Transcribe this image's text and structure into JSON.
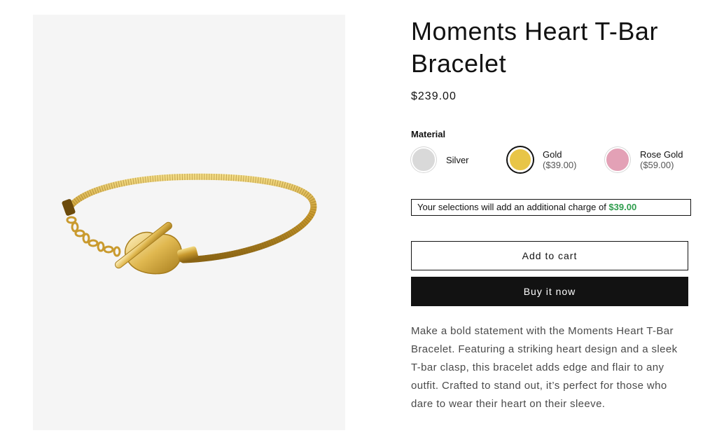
{
  "product": {
    "title": "Moments Heart T-Bar Bracelet",
    "price": "$239.00",
    "image_alt": "Moments Heart T-Bar Bracelet gold snake chain with heart T-bar clasp"
  },
  "material": {
    "label": "Material",
    "options": [
      {
        "name": "Silver",
        "price": "",
        "color": "#d9d9d9",
        "selected": false
      },
      {
        "name": "Gold",
        "price": "($39.00)",
        "color": "#e8c547",
        "selected": true
      },
      {
        "name": "Rose Gold",
        "price": "($59.00)",
        "color": "#e3a1b6",
        "selected": false
      }
    ]
  },
  "charge_notice": {
    "text": "Your selections will add an additional charge of ",
    "amount": "$39.00",
    "amount_color": "#2e9d4d"
  },
  "actions": {
    "add_to_cart": "Add to cart",
    "buy_now": "Buy it now"
  },
  "description": "Make a bold statement with the Moments Heart T-Bar Bracelet. Featuring a striking heart design and a sleek T-bar clasp, this bracelet adds edge and flair to any outfit. Crafted to stand out, it’s perfect for those who dare to wear their heart on their sleeve."
}
